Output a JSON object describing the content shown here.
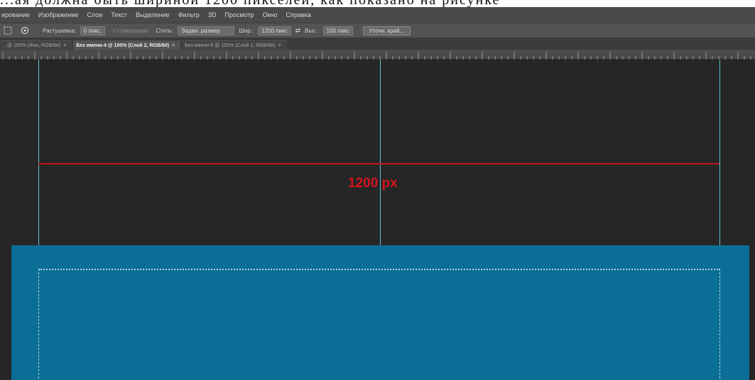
{
  "top_strip": {
    "text": "...ая должна быть шириной 1200 пикселей, как показано на рисунке"
  },
  "menubar": {
    "items": [
      "ирование",
      "Изображение",
      "Слои",
      "Текст",
      "Выделение",
      "Фильтр",
      "3D",
      "Просмотр",
      "Окно",
      "Справка"
    ]
  },
  "options": {
    "feather_label": "Растушевка:",
    "feather_value": "0 пикс.",
    "antialias_label": "Сглаживание",
    "style_label": "Стиль:",
    "style_value": "Задан. размер",
    "width_label": "Шир.:",
    "width_value": "1200 пикс",
    "height_label": "Выс.:",
    "height_value": "100 пикс",
    "refine_button": "Уточн. край..."
  },
  "tabs": [
    {
      "label": "...@ 100% (Фон, RGB/8#)",
      "active": false
    },
    {
      "label": "Без имени-4 @ 100% (Слой 2, RGB/8#)",
      "active": true
    },
    {
      "label": "Без имени-5 @ 100% (Слой 1, RGB/8#)",
      "active": false
    }
  ],
  "canvas": {
    "measure_label": "1200 px",
    "measure_color": "#d3141f",
    "guide_color": "#5fc3d0",
    "block_color": "#0a6e96"
  },
  "icons": {
    "tool": "marquee-tool-icon",
    "mode": "selection-mode-icon",
    "swap": "swap-arrows-icon"
  }
}
